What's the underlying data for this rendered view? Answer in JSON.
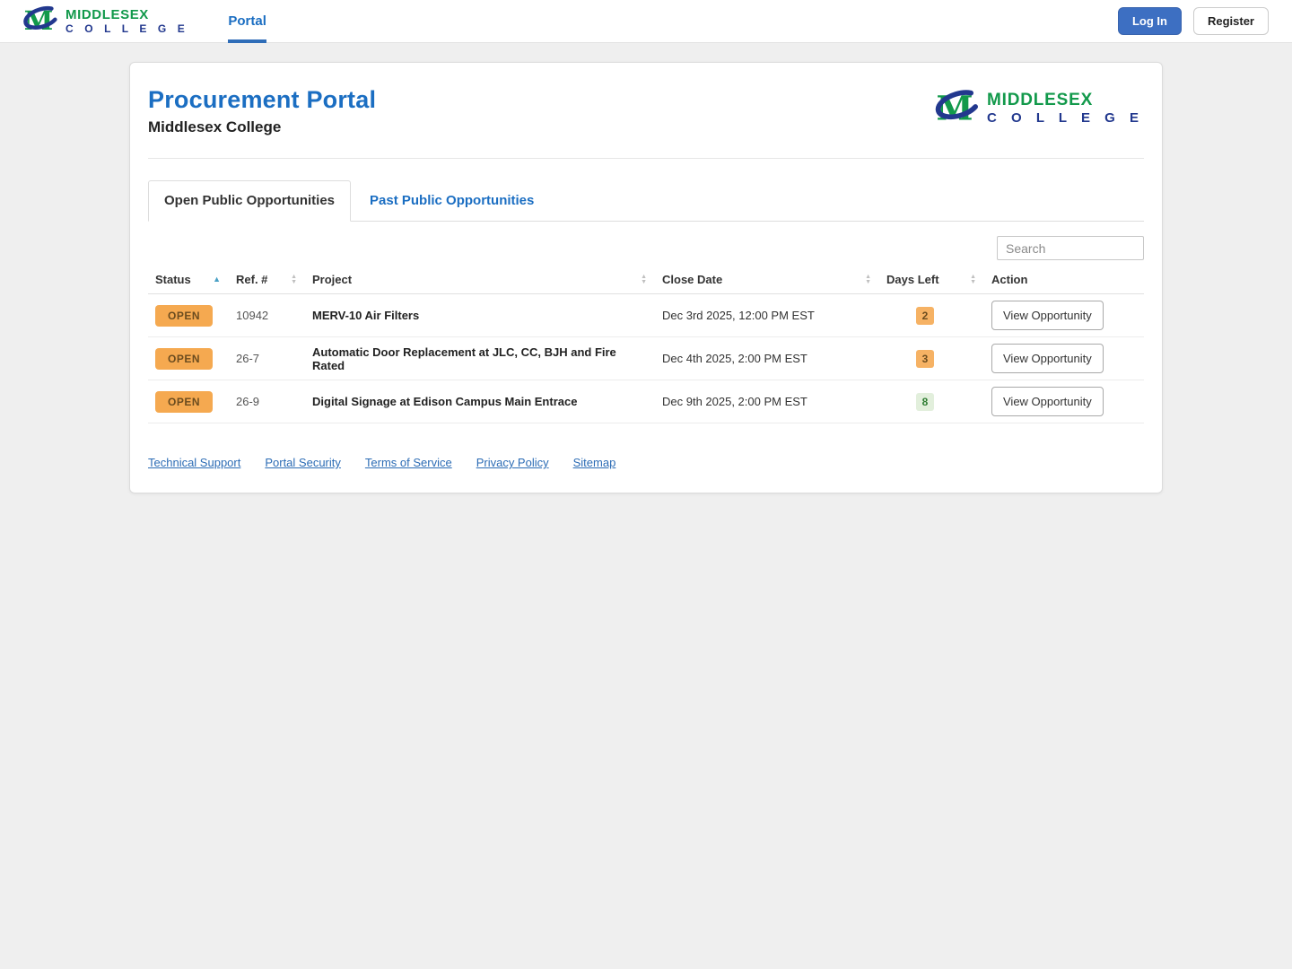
{
  "topbar": {
    "brand": {
      "line1": "MIDDLESEX",
      "line2": "C O L L E G E"
    },
    "nav_portal_label": "Portal",
    "login_label": "Log In",
    "register_label": "Register"
  },
  "portal": {
    "title": "Procurement Portal",
    "subtitle": "Middlesex College",
    "tabs": [
      {
        "label": "Open Public Opportunities",
        "active": true
      },
      {
        "label": "Past Public Opportunities",
        "active": false
      }
    ],
    "search_placeholder": "Search",
    "table": {
      "columns": [
        {
          "label": "Status",
          "sort": "asc"
        },
        {
          "label": "Ref. #",
          "sort": "both"
        },
        {
          "label": "Project",
          "sort": "both"
        },
        {
          "label": "Close Date",
          "sort": "both"
        },
        {
          "label": "Days Left",
          "sort": "both"
        },
        {
          "label": "Action",
          "sort": "none"
        }
      ],
      "rows": [
        {
          "status": "OPEN",
          "ref": "10942",
          "project": "MERV-10 Air Filters",
          "close_date": "Dec 3rd 2025, 12:00 PM EST",
          "days_left": "2",
          "days_left_color": "orange",
          "action": "View Opportunity"
        },
        {
          "status": "OPEN",
          "ref": "26-7",
          "project": "Automatic Door Replacement at JLC, CC, BJH and Fire Rated",
          "close_date": "Dec 4th 2025, 2:00 PM EST",
          "days_left": "3",
          "days_left_color": "orange",
          "action": "View Opportunity"
        },
        {
          "status": "OPEN",
          "ref": "26-9",
          "project": "Digital Signage at Edison Campus Main Entrace",
          "close_date": "Dec 9th 2025, 2:00 PM EST",
          "days_left": "8",
          "days_left_color": "green",
          "action": "View Opportunity"
        }
      ]
    },
    "footer_links": [
      {
        "label": "Technical Support"
      },
      {
        "label": "Portal Security"
      },
      {
        "label": "Terms of Service"
      },
      {
        "label": "Privacy Policy"
      },
      {
        "label": "Sitemap"
      }
    ]
  },
  "icons": {
    "sort_up": "▲",
    "sort_down": "▼"
  },
  "colors": {
    "primary_blue": "#1b6ec2",
    "login_button_blue": "#3d6fc2",
    "brand_green": "#12994b",
    "brand_navy": "#22388e",
    "open_badge_bg": "#f5a950",
    "open_badge_text": "#6b4c1f",
    "days_left_orange_bg": "#f6b264",
    "days_left_green_bg": "#e2efdc",
    "days_left_green_text": "#2f7d33",
    "page_background": "#efefef"
  }
}
